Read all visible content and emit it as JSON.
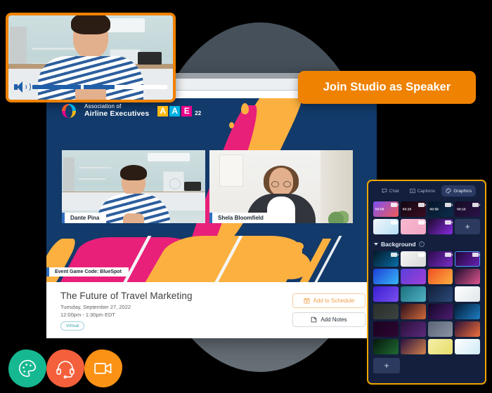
{
  "cta": {
    "label": "Join Studio as Speaker",
    "color": "#ef8200"
  },
  "preview": {
    "speaker_icon": "volume-icon",
    "progress_percent": 61
  },
  "event_stage": {
    "logo": {
      "line1": "Association of",
      "line2": "Airline Executives",
      "letters": [
        "A",
        "A",
        "E"
      ],
      "letter_colors": [
        "#fdb913",
        "#00b2e3",
        "#ec008c"
      ],
      "year": "22"
    },
    "participants": [
      {
        "name": "Dante Pina"
      },
      {
        "name": "Shela Bloomfield"
      }
    ],
    "game_code": "Event Game Code: BlueSpot",
    "brand_colors": {
      "navy": "#133b6b",
      "pink": "#e8207a",
      "yellow": "#fcb040"
    }
  },
  "session": {
    "title": "The Future of Travel Marketing",
    "date": "Tuesday, September 27, 2022",
    "time": "12:00pm - 1:30pm EDT",
    "badge": "Virtual",
    "buttons": [
      {
        "label": "Add to Schedule",
        "icon": "calendar-plus-icon",
        "color": "#f0a04b"
      },
      {
        "label": "Add Notes",
        "icon": "note-icon",
        "color": "#25303b"
      }
    ]
  },
  "graphics_panel": {
    "tabs": [
      {
        "label": "Chat",
        "icon": "chat-icon",
        "active": false
      },
      {
        "label": "Captions",
        "icon": "captions-icon",
        "active": false
      },
      {
        "label": "Graphics",
        "icon": "palette-icon",
        "active": true
      }
    ],
    "overlays": [
      {
        "timer": "00:59",
        "color1": "#7b4ff5",
        "color2": "#f25c54",
        "has_camera": true
      },
      {
        "timer": "00:29",
        "color1": "#120712",
        "color2": "#3a0d22",
        "has_camera": true
      },
      {
        "timer": "00:59",
        "color1": "#061426",
        "color2": "#0c2d4c",
        "has_camera": true
      },
      {
        "timer": "00:10",
        "color1": "#140b24",
        "color2": "#2a1348",
        "has_camera": true
      },
      {
        "timer": "",
        "color1": "#f2f6fa",
        "color2": "#b6e0f5",
        "has_camera": true
      },
      {
        "timer": "",
        "color1": "#f6b9cf",
        "color2": "#f2a6c4",
        "has_camera": true
      },
      {
        "timer": "",
        "color1": "#1c0a2e",
        "color2": "#8a2be2",
        "has_camera": true
      }
    ],
    "add_overlay_label": "+",
    "background_section": {
      "title": "Background",
      "info_icon": "info-icon",
      "chevron": "chevron-down-icon",
      "items": [
        {
          "color1": "#021824",
          "color2": "#0a6ea8",
          "has_camera": true,
          "selected": false
        },
        {
          "color1": "#f7f7f7",
          "color2": "#d6d6d6",
          "has_camera": true,
          "selected": false
        },
        {
          "color1": "#2b0b4a",
          "color2": "#7a2ec9",
          "has_camera": true,
          "selected": false
        },
        {
          "color1": "#1b0733",
          "color2": "#6b21b5",
          "has_camera": true,
          "selected": true
        },
        {
          "color1": "#1b3fd8",
          "color2": "#39b6f5",
          "has_camera": false,
          "selected": false
        },
        {
          "color1": "#5b3fd8",
          "color2": "#a03fd8",
          "has_camera": false,
          "selected": false
        },
        {
          "color1": "#f04e23",
          "color2": "#fbb040",
          "has_camera": false,
          "selected": false
        },
        {
          "color1": "#1d0d2e",
          "color2": "#e0568f",
          "has_camera": false,
          "selected": false
        },
        {
          "color1": "#3a1fd0",
          "color2": "#7a4ff0",
          "has_camera": false,
          "selected": false
        },
        {
          "color1": "#1b6f7d",
          "color2": "#4fb3c4",
          "has_camera": false,
          "selected": false
        },
        {
          "color1": "#12203a",
          "color2": "#2b4a78",
          "has_camera": false,
          "selected": false
        },
        {
          "color1": "#ffffff",
          "color2": "#dfe6ea",
          "has_camera": false,
          "selected": false
        },
        {
          "color1": "#2a2f2c",
          "color2": "#3c433f",
          "has_camera": false,
          "selected": false
        },
        {
          "color1": "#2a0e1c",
          "color2": "#d06a3a",
          "has_camera": false,
          "selected": false
        },
        {
          "color1": "#130629",
          "color2": "#4b1d6e",
          "has_camera": false,
          "selected": false
        },
        {
          "color1": "#041a33",
          "color2": "#1c7fc4",
          "has_camera": false,
          "selected": false
        },
        {
          "color1": "#1a0320",
          "color2": "#2d0733",
          "has_camera": false,
          "selected": false
        },
        {
          "color1": "#2a0f3c",
          "color2": "#5b2a7a",
          "has_camera": false,
          "selected": false
        },
        {
          "color1": "#5b6577",
          "color2": "#8b93a2",
          "has_camera": false,
          "selected": false
        },
        {
          "color1": "#2c1036",
          "color2": "#f0703c",
          "has_camera": false,
          "selected": false
        },
        {
          "color1": "#06170c",
          "color2": "#1f6b33",
          "has_camera": false,
          "selected": false
        },
        {
          "color1": "#2a1140",
          "color2": "#d2824a",
          "has_camera": false,
          "selected": false
        },
        {
          "color1": "#f4f0a8",
          "color2": "#e8dc6a",
          "has_camera": false,
          "selected": false
        },
        {
          "color1": "#ffffff",
          "color2": "#cfeaf5",
          "has_camera": false,
          "selected": false
        }
      ],
      "add_label": "+"
    }
  },
  "feature_icons": [
    {
      "name": "palette-icon",
      "color": "#16b891"
    },
    {
      "name": "headset-icon",
      "color": "#f4603c"
    },
    {
      "name": "video-camera-icon",
      "color": "#fb9215"
    }
  ]
}
